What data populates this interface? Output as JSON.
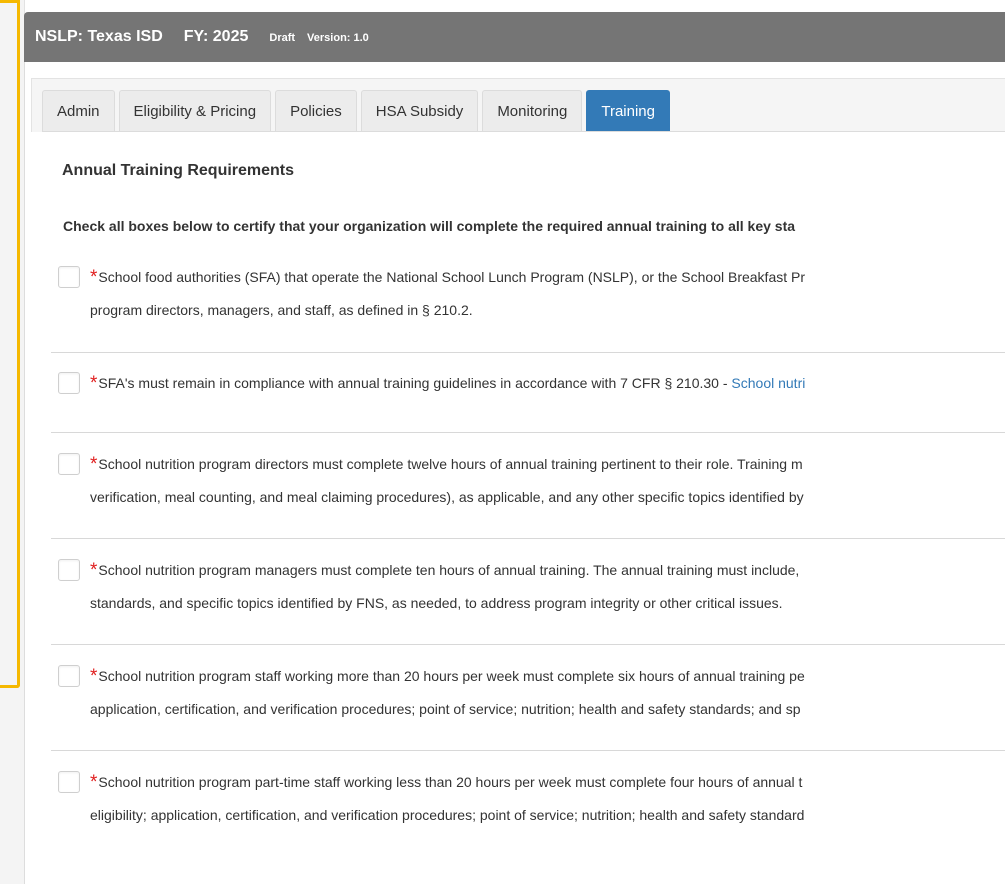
{
  "header": {
    "program": "NSLP: Texas ISD",
    "fiscal_year": "FY: 2025",
    "status": "Draft",
    "version": "Version: 1.0"
  },
  "tabs": [
    {
      "label": "Admin"
    },
    {
      "label": "Eligibility & Pricing"
    },
    {
      "label": "Policies"
    },
    {
      "label": "HSA Subsidy"
    },
    {
      "label": "Monitoring"
    },
    {
      "label": "Training"
    }
  ],
  "active_tab": "Training",
  "section": {
    "title": "Annual Training Requirements",
    "instructions": "Check all boxes below to certify that your organization will complete the required annual training to all key sta"
  },
  "requirements": [
    {
      "required_mark": "*",
      "line1": "School food authorities (SFA) that operate the National School Lunch Program (NSLP), or the School Breakfast Pr",
      "line2": "program directors, managers, and staff, as defined in § 210.2."
    },
    {
      "required_mark": "*",
      "line1": "SFA's must remain in compliance with annual training guidelines in accordance with 7 CFR § 210.30 - ",
      "link": "School nutri"
    },
    {
      "required_mark": "*",
      "line1": "School nutrition program directors must complete twelve hours of annual training pertinent to their role. Training m",
      "line2": "verification, meal counting, and meal claiming procedures), as applicable, and any other specific topics identified by"
    },
    {
      "required_mark": "*",
      "line1": "School nutrition program managers must complete ten hours of annual training. The annual training must include,",
      "line2": "standards, and specific topics identified by FNS, as needed, to address program integrity or other critical issues."
    },
    {
      "required_mark": "*",
      "line1": "School nutrition program staff working more than 20 hours per week must complete six hours of annual training pe",
      "line2": "application, certification, and verification procedures; point of service; nutrition; health and safety standards; and sp"
    },
    {
      "required_mark": "*",
      "line1": "School nutrition program part-time staff working less than 20 hours per week must complete four hours of annual t",
      "line2": "eligibility; application, certification, and verification procedures; point of service; nutrition; health and safety standard"
    }
  ],
  "colors": {
    "header_bg": "#757575",
    "active_tab": "#337ab7",
    "required": "#e02020",
    "link": "#337ab7",
    "highlight": "#f5b800"
  }
}
